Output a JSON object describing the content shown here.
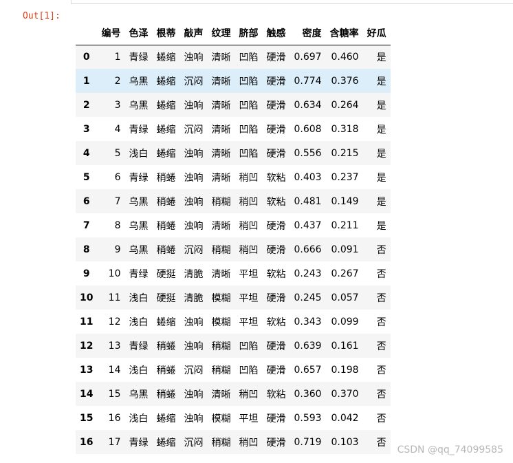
{
  "prompt": "Out[1]:",
  "watermark": "CSDN @qq_74099585",
  "table": {
    "columns": [
      "",
      "编号",
      "色泽",
      "根蒂",
      "敲声",
      "纹理",
      "脐部",
      "触感",
      "密度",
      "含糖率",
      "好瓜"
    ],
    "rows": [
      [
        "0",
        "1",
        "青绿",
        "蜷缩",
        "浊响",
        "清晰",
        "凹陷",
        "硬滑",
        "0.697",
        "0.460",
        "是"
      ],
      [
        "1",
        "2",
        "乌黑",
        "蜷缩",
        "沉闷",
        "清晰",
        "凹陷",
        "硬滑",
        "0.774",
        "0.376",
        "是"
      ],
      [
        "2",
        "3",
        "乌黑",
        "蜷缩",
        "浊响",
        "清晰",
        "凹陷",
        "硬滑",
        "0.634",
        "0.264",
        "是"
      ],
      [
        "3",
        "4",
        "青绿",
        "蜷缩",
        "沉闷",
        "清晰",
        "凹陷",
        "硬滑",
        "0.608",
        "0.318",
        "是"
      ],
      [
        "4",
        "5",
        "浅白",
        "蜷缩",
        "浊响",
        "清晰",
        "凹陷",
        "硬滑",
        "0.556",
        "0.215",
        "是"
      ],
      [
        "5",
        "6",
        "青绿",
        "稍蜷",
        "浊响",
        "清晰",
        "稍凹",
        "软粘",
        "0.403",
        "0.237",
        "是"
      ],
      [
        "6",
        "7",
        "乌黑",
        "稍蜷",
        "浊响",
        "稍糊",
        "稍凹",
        "软粘",
        "0.481",
        "0.149",
        "是"
      ],
      [
        "7",
        "8",
        "乌黑",
        "稍蜷",
        "浊响",
        "清晰",
        "稍凹",
        "硬滑",
        "0.437",
        "0.211",
        "是"
      ],
      [
        "8",
        "9",
        "乌黑",
        "稍蜷",
        "沉闷",
        "稍糊",
        "稍凹",
        "硬滑",
        "0.666",
        "0.091",
        "否"
      ],
      [
        "9",
        "10",
        "青绿",
        "硬挺",
        "清脆",
        "清晰",
        "平坦",
        "软粘",
        "0.243",
        "0.267",
        "否"
      ],
      [
        "10",
        "11",
        "浅白",
        "硬挺",
        "清脆",
        "模糊",
        "平坦",
        "硬滑",
        "0.245",
        "0.057",
        "否"
      ],
      [
        "11",
        "12",
        "浅白",
        "蜷缩",
        "浊响",
        "模糊",
        "平坦",
        "软粘",
        "0.343",
        "0.099",
        "否"
      ],
      [
        "12",
        "13",
        "青绿",
        "稍蜷",
        "浊响",
        "稍糊",
        "凹陷",
        "硬滑",
        "0.639",
        "0.161",
        "否"
      ],
      [
        "13",
        "14",
        "浅白",
        "稍蜷",
        "沉闷",
        "稍糊",
        "凹陷",
        "硬滑",
        "0.657",
        "0.198",
        "否"
      ],
      [
        "14",
        "15",
        "乌黑",
        "稍蜷",
        "浊响",
        "清晰",
        "稍凹",
        "软粘",
        "0.360",
        "0.370",
        "否"
      ],
      [
        "15",
        "16",
        "浅白",
        "蜷缩",
        "浊响",
        "模糊",
        "平坦",
        "硬滑",
        "0.593",
        "0.042",
        "否"
      ],
      [
        "16",
        "17",
        "青绿",
        "蜷缩",
        "沉闷",
        "稍糊",
        "稍凹",
        "硬滑",
        "0.719",
        "0.103",
        "否"
      ]
    ],
    "highlighted_row": 1,
    "colors": {
      "row_stripe": "#f5f5f5",
      "row_hover": "#ddeefb",
      "prompt": "#d84315"
    }
  }
}
